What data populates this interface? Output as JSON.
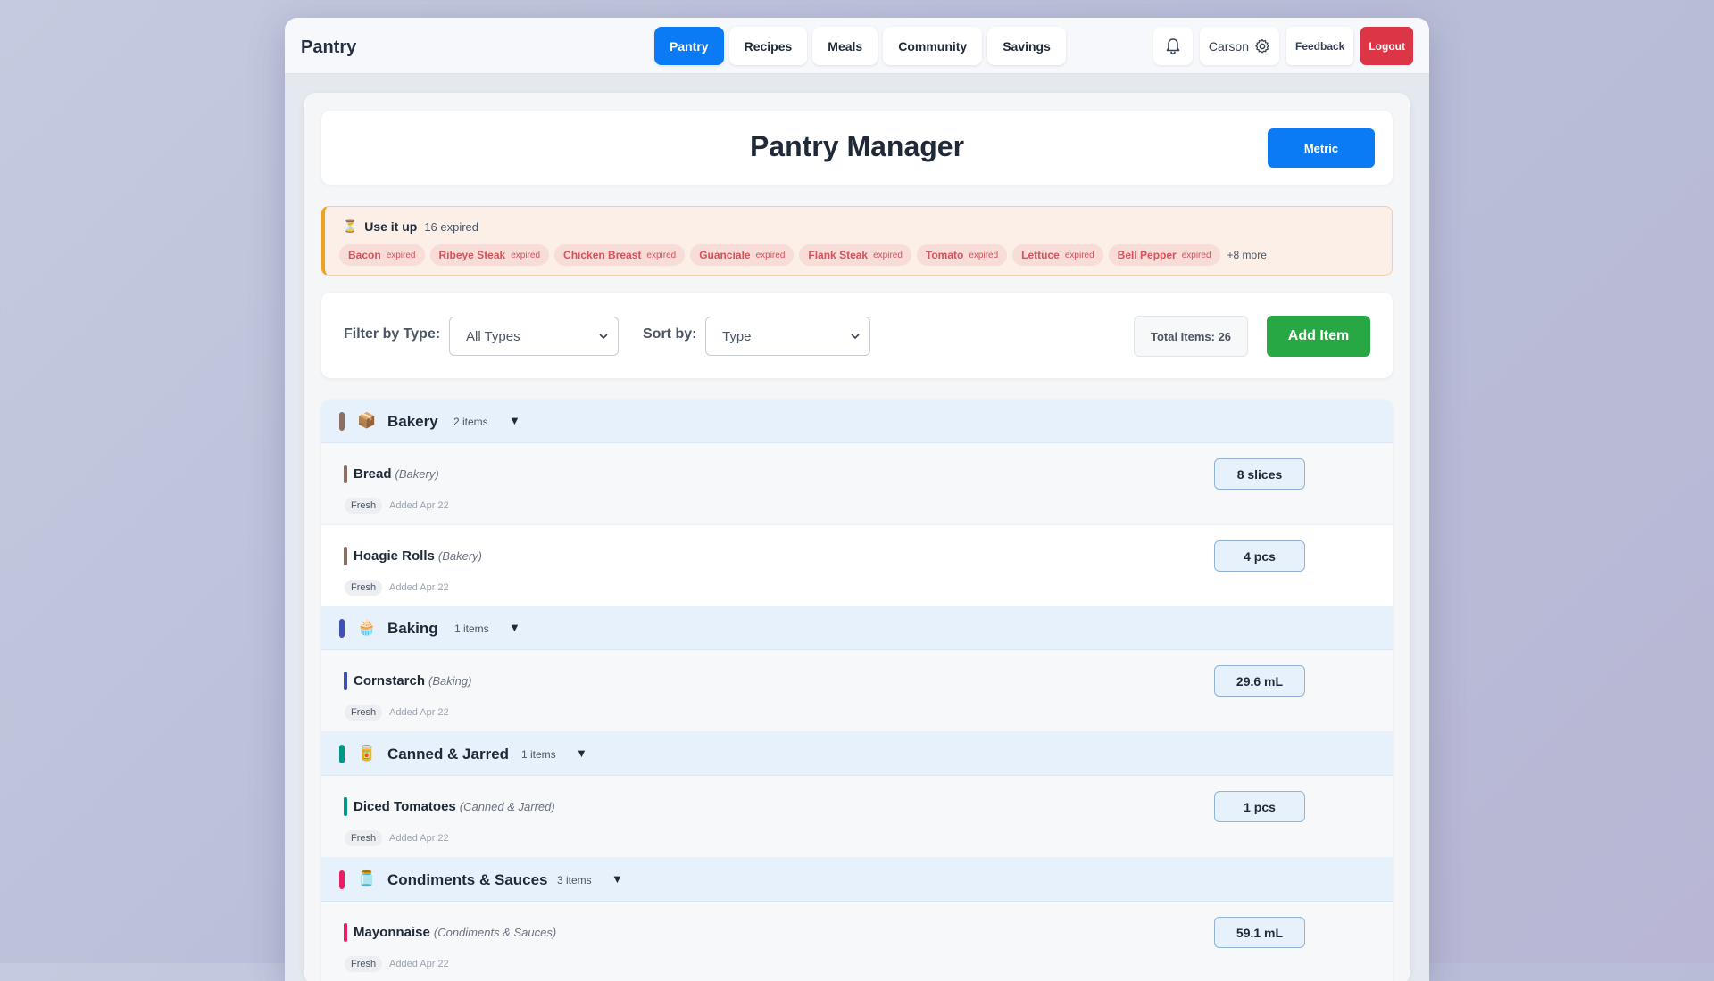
{
  "nav": {
    "brand": "Pantry",
    "tabs": [
      {
        "label": "Pantry",
        "active": true
      },
      {
        "label": "Recipes"
      },
      {
        "label": "Meals"
      },
      {
        "label": "Community"
      },
      {
        "label": "Savings"
      }
    ],
    "user": "Carson",
    "feedback": "Feedback",
    "logout": "Logout"
  },
  "header": {
    "title": "Pantry Manager",
    "metric_button": "Metric"
  },
  "use_it_up": {
    "title": "Use it up",
    "count": "16 expired",
    "chip_suffix": "expired",
    "items": [
      "Bacon",
      "Ribeye Steak",
      "Chicken Breast",
      "Guanciale",
      "Flank Steak",
      "Tomato",
      "Lettuce",
      "Bell Pepper"
    ],
    "more": "+8 more"
  },
  "filters": {
    "filter_label": "Filter by Type:",
    "filter_value": "All Types",
    "sort_label": "Sort by:",
    "sort_value": "Type",
    "total": "Total Items: 26",
    "add_button": "Add Item"
  },
  "categories": [
    {
      "name": "Bakery",
      "emoji": "📦",
      "count": "2 items",
      "color": "#8d6e63",
      "items": [
        {
          "name": "Bread",
          "type": "(Bakery)",
          "status": "Fresh",
          "added": "Added Apr 22",
          "qty": "8 slices"
        },
        {
          "name": "Hoagie Rolls",
          "type": "(Bakery)",
          "status": "Fresh",
          "added": "Added Apr 22",
          "qty": "4 pcs"
        }
      ]
    },
    {
      "name": "Baking",
      "emoji": "🧁",
      "count": "1 items",
      "color": "#3f51b5",
      "items": [
        {
          "name": "Cornstarch",
          "type": "(Baking)",
          "status": "Fresh",
          "added": "Added Apr 22",
          "qty": "29.6 mL"
        }
      ]
    },
    {
      "name": "Canned & Jarred",
      "emoji": "🥫",
      "count": "1 items",
      "color": "#009688",
      "items": [
        {
          "name": "Diced Tomatoes",
          "type": "(Canned & Jarred)",
          "status": "Fresh",
          "added": "Added Apr 22",
          "qty": "1 pcs"
        }
      ]
    },
    {
      "name": "Condiments & Sauces",
      "emoji": "🫙",
      "count": "3 items",
      "color": "#e91e63",
      "items": [
        {
          "name": "Mayonnaise",
          "type": "(Condiments & Sauces)",
          "status": "Fresh",
          "added": "Added Apr 22",
          "qty": "59.1 mL"
        }
      ]
    }
  ]
}
